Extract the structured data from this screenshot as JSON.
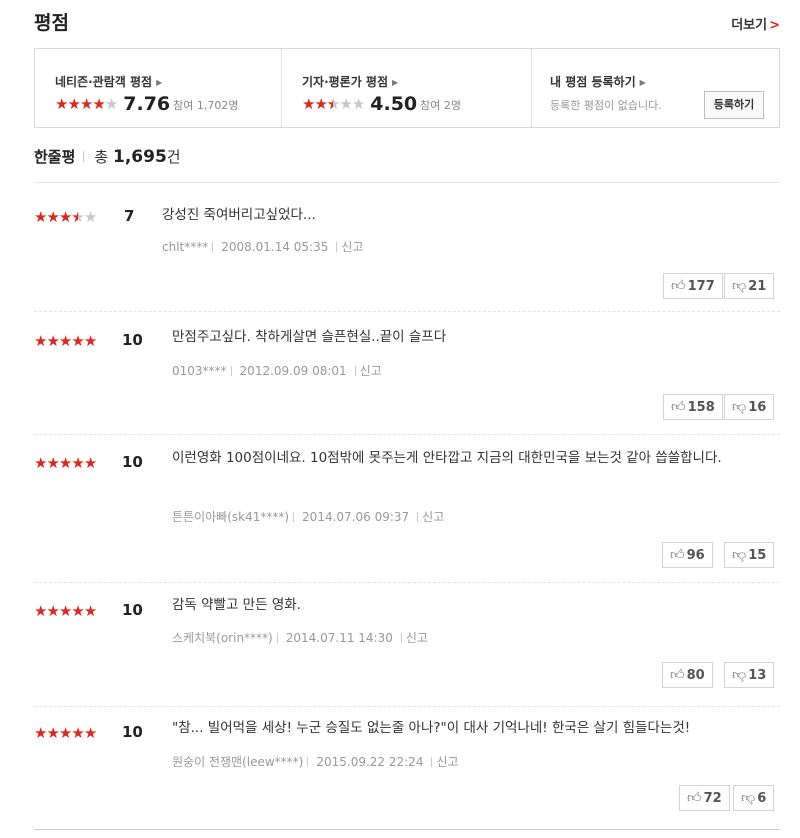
{
  "header": {
    "title": "평점",
    "more_label": "더보기"
  },
  "summary": {
    "netizen": {
      "label": "네티즌·관람객 평점",
      "rating": 4,
      "score": "7.76",
      "count": "참여 1,702명"
    },
    "critic": {
      "label": "기자·평론가 평점",
      "rating": 2.5,
      "score": "4.50",
      "count": "참여 2명"
    },
    "mine": {
      "label": "내 평점 등록하기",
      "empty": "등록한 평점이 없습니다.",
      "button": "등록하기"
    }
  },
  "count_header": {
    "title": "한줄평",
    "total_prefix": "총",
    "total": "1,695",
    "suffix": "건"
  },
  "reviews": [
    {
      "rating": 3.5,
      "score": "7",
      "text": "강성진 죽여버리고싶었다...",
      "author": "chlt****",
      "date": "2008.01.14 05:35",
      "report": "신고",
      "likes": "177",
      "dislikes": "21"
    },
    {
      "rating": 5,
      "score": "10",
      "text": "만점주고싶다. 착하게살면 슬픈현실..끝이 슬프다",
      "author": "0103****",
      "date": "2012.09.09 08:01",
      "report": "신고",
      "likes": "158",
      "dislikes": "16"
    },
    {
      "rating": 5,
      "score": "10",
      "text": "이런영화 100점이네요. 10점밖에 못주는게 안타깝고 지금의 대한민국을 보는것 같아 씁쓸합니다.",
      "author": "튼튼이아빠(sk41****)",
      "date": "2014.07.06 09:37",
      "report": "신고",
      "likes": "96",
      "dislikes": "15"
    },
    {
      "rating": 5,
      "score": "10",
      "text": "감독 약빨고 만든 영화.",
      "author": "스케치북(orin****)",
      "date": "2014.07.11 14:30",
      "report": "신고",
      "likes": "80",
      "dislikes": "13"
    },
    {
      "rating": 5,
      "score": "10",
      "text": "\"참... 빌어먹을 세상! 누군 승질도 없는줄 아나?\"이 대사 기억나네! 한국은 살기 힘들다는것!",
      "author": "원숭이 전쟁맨(leew****)",
      "date": "2015.09.22 22:24",
      "report": "신고",
      "likes": "72",
      "dislikes": "6"
    }
  ],
  "colors": {
    "accent": "#e0271e",
    "star_empty": "#c8c8c8"
  },
  "icons": {
    "like": "thumbs-up-icon",
    "dislike": "thumbs-down-icon",
    "more": "chevron-right-icon"
  }
}
